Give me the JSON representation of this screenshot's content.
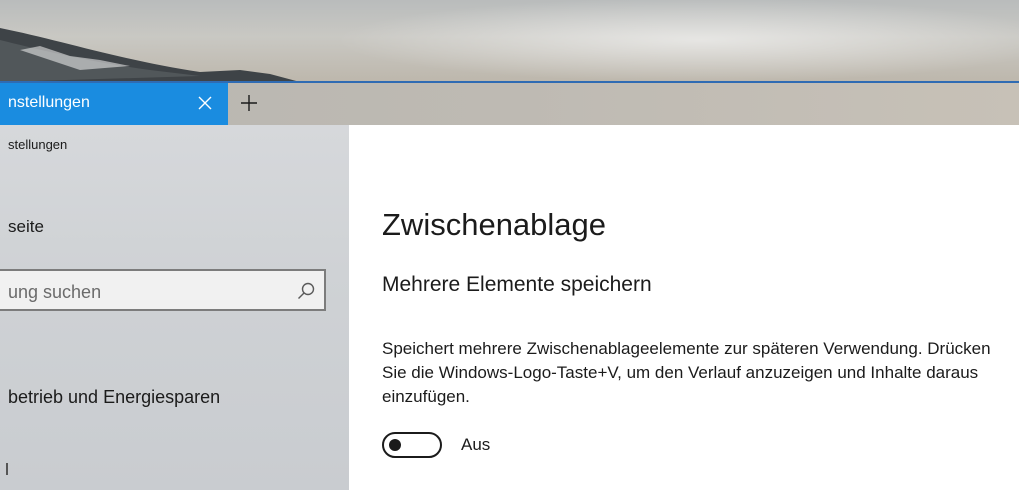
{
  "window": {
    "tab_title": "nstellungen",
    "close_symbol": "✕",
    "new_tab_symbol": "+",
    "accent_color": "#1a8ce0"
  },
  "sidebar": {
    "breadcrumb": "stellungen",
    "home_label": "seite",
    "search_placeholder": "ung suchen",
    "search_icon": "search-icon",
    "items": [
      {
        "label": "betrieb und Energiesparen"
      }
    ]
  },
  "main": {
    "page_title": "Zwischenablage",
    "section_title": "Mehrere Elemente speichern",
    "description": "Speichert mehrere Zwischenablageelemente zur späteren Verwendung. Drücken Sie die Windows-Logo-Taste+V, um den Verlauf anzuzeigen und Inhalte daraus einzufügen.",
    "toggle": {
      "state": "off",
      "label": "Aus"
    }
  }
}
